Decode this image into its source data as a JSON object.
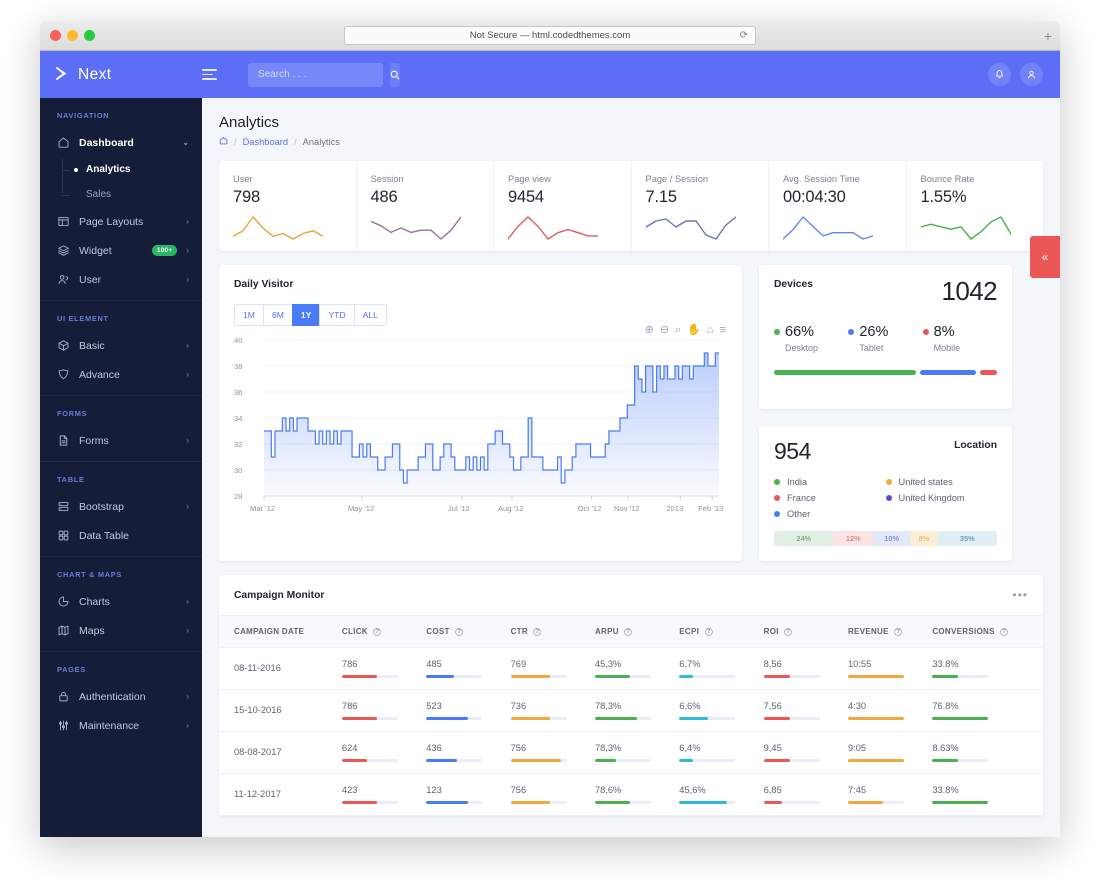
{
  "browser": {
    "url_text": "Not Secure — html.codedthemes.com",
    "reload_icon": "reload-icon",
    "new_tab_icon": "plus-icon"
  },
  "topbar": {
    "brand": "Next",
    "brand_mark_icon": "next-logo-icon",
    "menu_toggle_icon": "hamburger-icon",
    "search_placeholder": "Search . . .",
    "search_value": "",
    "search_icon": "search-icon",
    "notification_icon": "bell-icon",
    "profile_icon": "user-icon",
    "bg_color": "#5b6ef5"
  },
  "collapse_tab": {
    "icon": "double-chevron-left-icon",
    "color": "#eb5757"
  },
  "sidebar": {
    "sections": [
      {
        "caption": "NAVIGATION",
        "items": [
          {
            "label": "Dashboard",
            "icon": "home-icon",
            "chevron": "chevron-down-icon",
            "active": true,
            "subitems": [
              {
                "label": "Analytics",
                "active": true
              },
              {
                "label": "Sales",
                "active": false
              }
            ]
          },
          {
            "label": "Page Layouts",
            "icon": "layout-icon",
            "chevron": "chevron-right-icon"
          },
          {
            "label": "Widget",
            "icon": "layers-icon",
            "chevron": "chevron-right-icon",
            "badge": "100+",
            "badge_color": "#27b765"
          },
          {
            "label": "User",
            "icon": "users-icon",
            "chevron": "chevron-right-icon"
          }
        ]
      },
      {
        "caption": "UI ELEMENT",
        "items": [
          {
            "label": "Basic",
            "icon": "box-icon",
            "chevron": "chevron-right-icon"
          },
          {
            "label": "Advance",
            "icon": "shield-icon",
            "chevron": "chevron-right-icon"
          }
        ]
      },
      {
        "caption": "FORMS",
        "items": [
          {
            "label": "Forms",
            "icon": "file-icon",
            "chevron": "chevron-right-icon"
          }
        ]
      },
      {
        "caption": "TABLE",
        "items": [
          {
            "label": "Bootstrap",
            "icon": "server-icon",
            "chevron": "chevron-right-icon"
          },
          {
            "label": "Data Table",
            "icon": "grid-icon",
            "chevron": ""
          }
        ]
      },
      {
        "caption": "CHART & MAPS",
        "items": [
          {
            "label": "Charts",
            "icon": "pie-chart-icon",
            "chevron": "chevron-right-icon"
          },
          {
            "label": "Maps",
            "icon": "map-icon",
            "chevron": "chevron-right-icon"
          }
        ]
      },
      {
        "caption": "PAGES",
        "items": [
          {
            "label": "Authentication",
            "icon": "lock-icon",
            "chevron": "chevron-right-icon"
          },
          {
            "label": "Maintenance",
            "icon": "sliders-icon",
            "chevron": "chevron-right-icon"
          }
        ]
      }
    ]
  },
  "page": {
    "title": "Analytics",
    "breadcrumb": {
      "home_icon": "home-icon",
      "items": [
        "Dashboard",
        "Analytics"
      ]
    }
  },
  "kpis": [
    {
      "label": "User",
      "value": "798",
      "color": "#e8a33d",
      "spark": [
        14,
        16,
        21,
        17,
        14,
        15,
        13,
        15,
        16,
        14
      ]
    },
    {
      "label": "Session",
      "value": "486",
      "color": "#9b6f9b",
      "spark": [
        18,
        16,
        13,
        15,
        13,
        14,
        14,
        10,
        14,
        20
      ]
    },
    {
      "label": "Page view",
      "value": "9454",
      "color": "#e05b5b",
      "spark": [
        13,
        17,
        20,
        17,
        13,
        15,
        16,
        15,
        14,
        14
      ]
    },
    {
      "label": "Page / Session",
      "value": "7.15",
      "color": "#6a74b8",
      "spark": [
        15,
        18,
        19,
        15,
        18,
        18,
        11,
        9,
        16,
        20
      ]
    },
    {
      "label": "Avg. Session Time",
      "value": "00:04:30",
      "color": "#5b8bf0",
      "spark": [
        13,
        16,
        20,
        17,
        14,
        15,
        15,
        15,
        13,
        14
      ]
    },
    {
      "label": "Bounce Rate",
      "value": "1.55%",
      "color": "#4caf50",
      "spark": [
        16,
        17,
        16,
        15,
        16,
        11,
        14,
        18,
        20,
        13
      ]
    }
  ],
  "visitor_card": {
    "title": "Daily Visitor",
    "ranges": [
      {
        "label": "1M",
        "active": false
      },
      {
        "label": "6M",
        "active": false
      },
      {
        "label": "1Y",
        "active": true
      },
      {
        "label": "YTD",
        "active": false
      },
      {
        "label": "ALL",
        "active": false
      }
    ],
    "tools": [
      {
        "name": "zoom-in-icon",
        "glyph": "⊕"
      },
      {
        "name": "zoom-out-icon",
        "glyph": "⊖"
      },
      {
        "name": "selection-zoom-icon",
        "glyph": "⌕"
      },
      {
        "name": "pan-icon",
        "glyph": "✋"
      },
      {
        "name": "reset-home-icon",
        "glyph": "⌂"
      },
      {
        "name": "menu-icon",
        "glyph": "≡"
      }
    ]
  },
  "chart_data": {
    "type": "area",
    "title": "Daily Visitor",
    "xlabel": "",
    "ylabel": "",
    "ylim": [
      28,
      40
    ],
    "yticks": [
      28,
      30,
      32,
      34,
      36,
      38,
      40
    ],
    "xticks": [
      "Mar '12",
      "May '12",
      "Jul '12",
      "Aug '12",
      "Oct '12",
      "Nov '12",
      "2013",
      "Feb '13"
    ],
    "grid": true,
    "line_color": "#4a7bf7",
    "fill_color": "rgba(74,123,247,0.22)",
    "series": [
      {
        "name": "Daily Visitor",
        "values": [
          33,
          33,
          31,
          33,
          33,
          34,
          33,
          34,
          33,
          34,
          34,
          34,
          33,
          33,
          32,
          33,
          32,
          33,
          32,
          33,
          32,
          33,
          33,
          33,
          31,
          31,
          32,
          31,
          32,
          31,
          31,
          30,
          30,
          31,
          31,
          32,
          32,
          30,
          29,
          30,
          30,
          30,
          31,
          31,
          32,
          32,
          30,
          30,
          31,
          32,
          32,
          31,
          30,
          30,
          30,
          31,
          30,
          31,
          30,
          31,
          30,
          32,
          32,
          33,
          33,
          32,
          32,
          31,
          30,
          30,
          31,
          31,
          34,
          31,
          31,
          31,
          30,
          30,
          30,
          30,
          31,
          29,
          30,
          30,
          31,
          32,
          32,
          32,
          32,
          31,
          31,
          31,
          31,
          32,
          33,
          33,
          33,
          34,
          34,
          35,
          35,
          38,
          37,
          36,
          38,
          38,
          36,
          38,
          37,
          38,
          37,
          37,
          38,
          37,
          38,
          38,
          37,
          38,
          38,
          38,
          39,
          38,
          38,
          39,
          39
        ]
      }
    ]
  },
  "devices": {
    "title": "Devices",
    "total": "1042",
    "items": [
      {
        "pct": "66%",
        "name": "Desktop",
        "color": "#4caf50",
        "weight": 66
      },
      {
        "pct": "26%",
        "name": "Tablet",
        "color": "#4a7bf7",
        "weight": 26
      },
      {
        "pct": "8%",
        "name": "Mobile",
        "color": "#eb5757",
        "weight": 8
      }
    ]
  },
  "location": {
    "title": "Location",
    "total": "954",
    "legend": [
      {
        "label": "India",
        "color": "#4caf50"
      },
      {
        "label": "United states",
        "color": "#f0a93a"
      },
      {
        "label": "France",
        "color": "#eb5757"
      },
      {
        "label": "United Kingdom",
        "color": "#5b4fd1"
      },
      {
        "label": "Other",
        "color": "#4a7bf7"
      }
    ],
    "bar": [
      {
        "pct": "24%",
        "bg": "#e2f0e4",
        "fg": "#7fae85",
        "weight": 24
      },
      {
        "pct": "12%",
        "bg": "#fbe4e4",
        "fg": "#d98a8a",
        "weight": 16
      },
      {
        "pct": "10%",
        "bg": "#e2e9fb",
        "fg": "#7f93d2",
        "weight": 15
      },
      {
        "pct": "8%",
        "bg": "#fcedd7",
        "fg": "#e8bd7e",
        "weight": 11
      },
      {
        "pct": "35%",
        "bg": "#e0eef5",
        "fg": "#6f9eb5",
        "weight": 24
      }
    ]
  },
  "campaign": {
    "title": "Campaign Monitor",
    "menu_icon": "ellipsis-icon",
    "columns": [
      {
        "label": "CAMPAIGN DATE",
        "help": false
      },
      {
        "label": "CLICK",
        "help": true
      },
      {
        "label": "COST",
        "help": true
      },
      {
        "label": "CTR",
        "help": true
      },
      {
        "label": "ARPU",
        "help": true
      },
      {
        "label": "ECPI",
        "help": true
      },
      {
        "label": "ROI",
        "help": true
      },
      {
        "label": "REVENUE",
        "help": true
      },
      {
        "label": "CONVERSIONS",
        "help": true
      }
    ],
    "rows": [
      {
        "date": "08-11-2016",
        "cells": [
          {
            "value": "786",
            "color": "#eb5757",
            "pct": 62
          },
          {
            "value": "485",
            "color": "#4a7bf7",
            "pct": 50
          },
          {
            "value": "769",
            "color": "#f0a93a",
            "pct": 70
          },
          {
            "value": "45,3%",
            "color": "#4caf50",
            "pct": 62
          },
          {
            "value": "6,7%",
            "color": "#2fbcd4",
            "pct": 25
          },
          {
            "value": "8,56",
            "color": "#eb5757",
            "pct": 47
          },
          {
            "value": "10:55",
            "color": "#f0a93a",
            "pct": 100
          },
          {
            "value": "33.8%",
            "color": "#4caf50",
            "pct": 45
          }
        ]
      },
      {
        "date": "15-10-2016",
        "cells": [
          {
            "value": "786",
            "color": "#eb5757",
            "pct": 62
          },
          {
            "value": "523",
            "color": "#4a7bf7",
            "pct": 75
          },
          {
            "value": "736",
            "color": "#f0a93a",
            "pct": 70
          },
          {
            "value": "78,3%",
            "color": "#4caf50",
            "pct": 75
          },
          {
            "value": "6,6%",
            "color": "#2fbcd4",
            "pct": 52
          },
          {
            "value": "7,56",
            "color": "#eb5757",
            "pct": 47
          },
          {
            "value": "4:30",
            "color": "#f0a93a",
            "pct": 100
          },
          {
            "value": "76.8%",
            "color": "#4caf50",
            "pct": 100
          }
        ]
      },
      {
        "date": "08-08-2017",
        "cells": [
          {
            "value": "624",
            "color": "#eb5757",
            "pct": 45
          },
          {
            "value": "436",
            "color": "#4a7bf7",
            "pct": 55
          },
          {
            "value": "756",
            "color": "#f0a93a",
            "pct": 90
          },
          {
            "value": "78,3%",
            "color": "#4caf50",
            "pct": 38
          },
          {
            "value": "6,4%",
            "color": "#2fbcd4",
            "pct": 25
          },
          {
            "value": "9,45",
            "color": "#eb5757",
            "pct": 47
          },
          {
            "value": "9:05",
            "color": "#f0a93a",
            "pct": 100
          },
          {
            "value": "8.63%",
            "color": "#4caf50",
            "pct": 45
          }
        ]
      },
      {
        "date": "11-12-2017",
        "cells": [
          {
            "value": "423",
            "color": "#eb5757",
            "pct": 62
          },
          {
            "value": "123",
            "color": "#4a7bf7",
            "pct": 75
          },
          {
            "value": "756",
            "color": "#f0a93a",
            "pct": 70
          },
          {
            "value": "78,6%",
            "color": "#4caf50",
            "pct": 62
          },
          {
            "value": "45,6%",
            "color": "#2fbcd4",
            "pct": 85
          },
          {
            "value": "6,85",
            "color": "#eb5757",
            "pct": 33
          },
          {
            "value": "7:45",
            "color": "#f0a93a",
            "pct": 62
          },
          {
            "value": "33.8%",
            "color": "#4caf50",
            "pct": 100
          }
        ]
      }
    ]
  }
}
